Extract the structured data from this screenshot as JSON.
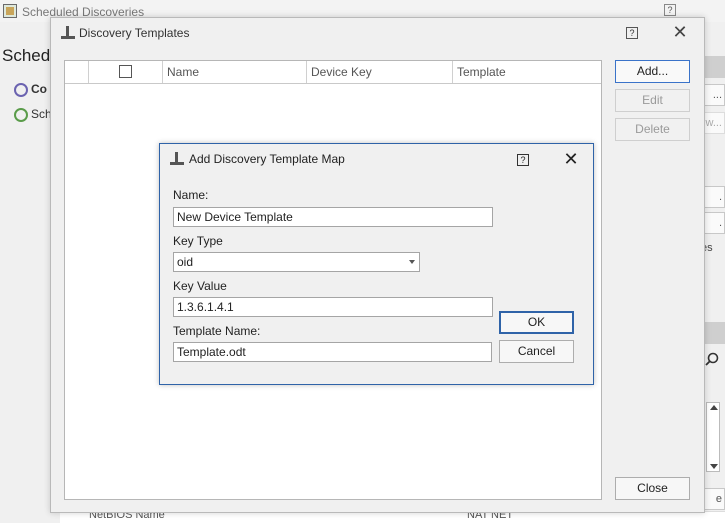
{
  "background_window": {
    "title": "Scheduled Discoveries",
    "help_glyph": "?",
    "heading": "Schedu",
    "nav_items": [
      {
        "label": "Co",
        "icon": "clock-alert-icon"
      },
      {
        "label": "Sch",
        "icon": "clock-add-icon"
      }
    ],
    "right_edge": {
      "btn1": "...",
      "btn2": "w...",
      "btn3": ".",
      "btn4": ".",
      "text": "es",
      "btn5": "e"
    },
    "bottom_row": {
      "col_a": "NetBIOS Name",
      "col_b": "NAT NET"
    }
  },
  "templates_dialog": {
    "title": "Discovery Templates",
    "help_glyph": "?",
    "close_glyph": "✕",
    "columns": [
      "Name",
      "Device Key",
      "Template"
    ],
    "rows": [],
    "buttons": {
      "add": "Add...",
      "edit": "Edit",
      "delete": "Delete",
      "close": "Close"
    }
  },
  "map_dialog": {
    "title": "Add Discovery Template Map",
    "help_glyph": "?",
    "close_glyph": "✕",
    "name_label": "Name:",
    "name_value": "New Device Template",
    "key_type_label": "Key Type",
    "key_type_value": "oid",
    "key_value_label": "Key Value",
    "key_value_value": "1.3.6.1.4.1",
    "template_name_label": "Template Name:",
    "template_name_value": "Template.odt",
    "ok_label": "OK",
    "cancel_label": "Cancel"
  }
}
